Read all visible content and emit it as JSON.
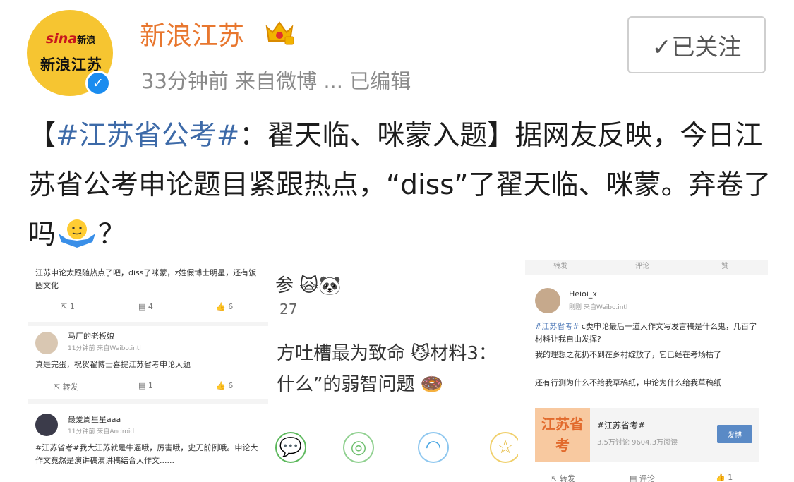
{
  "account": {
    "name": "新浪江苏",
    "avatar_logo": "sina",
    "avatar_logo_sub": "新浪",
    "avatar_calligraphy": "新浪江苏",
    "verified_icon": "verified-badge-icon",
    "crown_icon": "vip-crown-icon",
    "meta": "33分钟前  来自微博 ... 已编辑"
  },
  "follow_button": {
    "label": "✓已关注"
  },
  "post": {
    "bracket_open": "【",
    "hashtag": "#江苏省公考#",
    "title_rest": "：翟天临、咪蒙入题】据网友反映，今日江苏省公考申论题目紧跟热点，“diss”了翟天临、咪蒙。弃卷了吗",
    "tail": "？"
  },
  "images": {
    "img1": {
      "post1_text": "江苏申论太跟随热点了吧，diss了咪蒙，z姓假博士明星，还有饭圈文化",
      "post1_actions": [
        "1",
        "4",
        "6"
      ],
      "post2_user": "马厂的老板娘",
      "post2_meta": "11分钟前  来自Weibo.intl",
      "post2_text": "真是完蛋，祝贺翟博士喜提江苏省考申论大题",
      "post2_actions": [
        "转发",
        "1",
        "6"
      ],
      "post3_user": "最爱周星星aaa",
      "post3_meta": "11分钟前  来自Android",
      "post3_text": "#江苏省考#我大江苏就是牛逼哦，厉害哦，史无前例哦。申论大作文竟然是演讲稿",
      "post3_text_tail": "演讲稿结合大作文......"
    },
    "img2": {
      "line1": "参",
      "line2": "27",
      "line3": "方吐槽最为致命",
      "line3b": "材料3：",
      "line4": "什么”的弱智问题"
    },
    "img3": {
      "top_actions": [
        "转发",
        "评论",
        "赞"
      ],
      "user": "Heioi_x",
      "meta": "刚刚  来自Weibo.intl",
      "hashtag": "#江苏省考#",
      "text1": " c类申论最后一道大作文写发言稿是什么鬼，几百字材料让我自由发挥?",
      "text2": "我的理想之花扔不到在乡村绽放了，它已经在考场枯了",
      "text3": "还有行测为什么不给我草稿纸，申论为什么给我草稿纸",
      "topic_thumb": "江苏省考",
      "topic_title": "#江苏省考#",
      "topic_stats": "3.5万讨论  9604.3万阅读",
      "topic_button": "发博",
      "bottom_actions": [
        "转发",
        "评论",
        "1"
      ]
    }
  }
}
